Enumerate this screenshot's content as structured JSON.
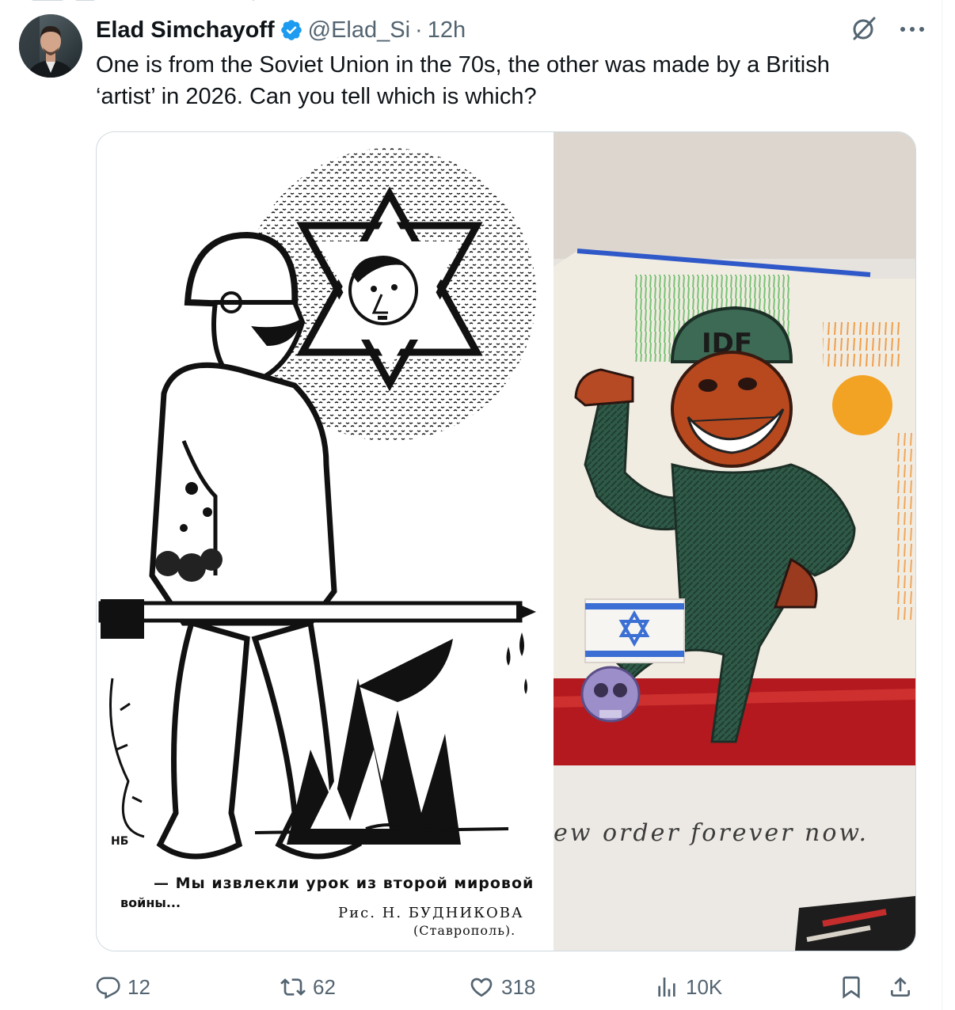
{
  "tweet": {
    "author_name": "Elad Simchayoff",
    "handle": "@Elad_Si",
    "separator": "·",
    "time": "12h",
    "text": "One is from the Soviet Union in the 70s, the other was made by a British\n‘artist’ in 2026. Can you tell which is which?"
  },
  "media": {
    "left_image": {
      "caption_line1": "— Мы извлекли урок из второй мировой",
      "caption_line2": "войны...",
      "credit_line1": "Рис. Н. БУДНИКОВА",
      "credit_line2": "(Ставрополь).",
      "monogram": "НБ"
    },
    "right_image": {
      "helmet_text": "IDF",
      "wall_text": "ew order forever   now."
    }
  },
  "actions": {
    "replies": "12",
    "reposts": "62",
    "likes": "318",
    "views": "10K"
  },
  "icons": {
    "verified": "verified-badge-icon",
    "grok": "grok-icon",
    "more": "more-icon",
    "reply": "reply-icon",
    "repost": "repost-icon",
    "like": "like-icon",
    "views": "views-icon",
    "bookmark": "bookmark-icon",
    "share": "share-icon"
  },
  "colors": {
    "verified_blue": "#1d9bf0",
    "secondary_text": "#536471",
    "primary_text": "#0f1419",
    "border": "#cfd9de"
  }
}
